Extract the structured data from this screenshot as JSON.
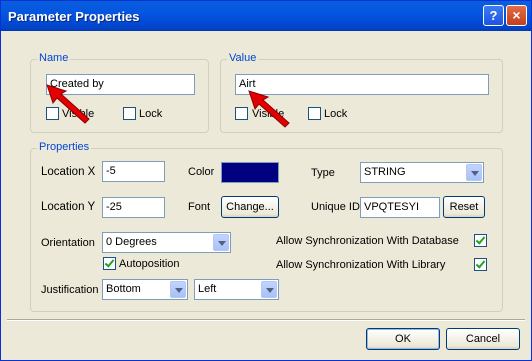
{
  "window": {
    "title": "Parameter Properties",
    "help_label": "?",
    "close_label": "×"
  },
  "name_group": {
    "label": "Name",
    "value": "Created by",
    "visible_label": "Visible",
    "lock_label": "Lock"
  },
  "value_group": {
    "label": "Value",
    "value": "Airt",
    "visible_label": "Visible",
    "lock_label": "Lock"
  },
  "properties": {
    "label": "Properties",
    "location_x_label": "Location X",
    "location_x": "-5",
    "location_y_label": "Location Y",
    "location_y": "-25",
    "color_label": "Color",
    "color_value": "#000080",
    "font_label": "Font",
    "change_button": "Change...",
    "type_label": "Type",
    "type_value": "STRING",
    "unique_id_label": "Unique ID",
    "unique_id": "VPQTESYI",
    "reset_button": "Reset",
    "orientation_label": "Orientation",
    "orientation_value": "0 Degrees",
    "autoposition_label": "Autoposition",
    "justification_label": "Justification",
    "justification_vertical": "Bottom",
    "justification_horizontal": "Left",
    "sync_db_label": "Allow Synchronization With Database",
    "sync_lib_label": "Allow Synchronization With Library"
  },
  "footer": {
    "ok_label": "OK",
    "cancel_label": "Cancel"
  }
}
